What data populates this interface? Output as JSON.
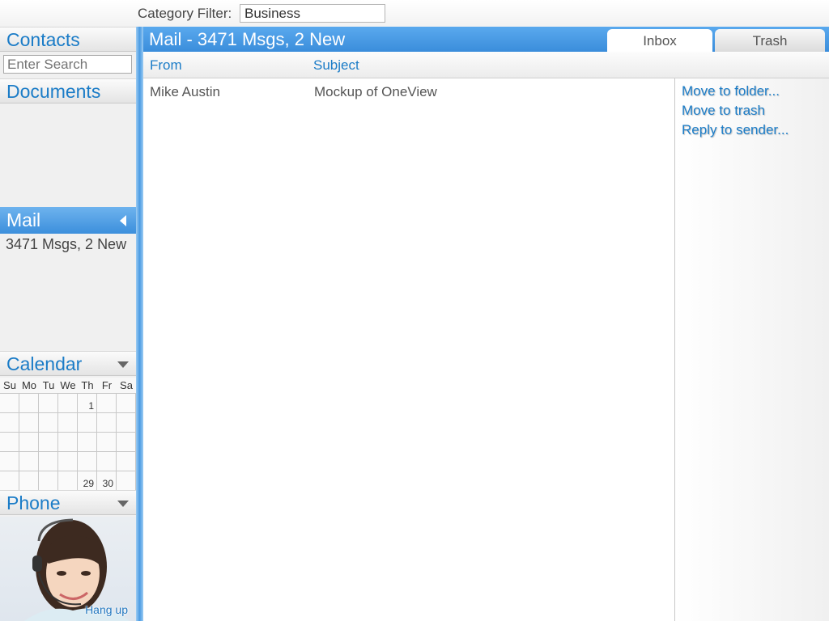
{
  "topbar": {
    "category_label": "Category Filter:",
    "category_value": "Business"
  },
  "sidebar": {
    "contacts": "Contacts",
    "search_placeholder": "Enter Search",
    "documents": "Documents",
    "mail": "Mail",
    "mail_summary": "3471 Msgs, 2 New",
    "calendar": "Calendar",
    "days": [
      "Su",
      "Mo",
      "Tu",
      "We",
      "Th",
      "Fr",
      "Sa"
    ],
    "dates": {
      "first": "1",
      "d29": "29",
      "d30": "30"
    },
    "phone": "Phone",
    "hangup": "Hang up"
  },
  "main": {
    "title": "Mail - 3471 Msgs, 2 New",
    "tabs": {
      "inbox": "Inbox",
      "trash": "Trash"
    },
    "columns": {
      "from": "From",
      "subject": "Subject"
    },
    "rows": [
      {
        "from": "Mike Austin",
        "subject": "Mockup of OneView"
      }
    ],
    "actions": {
      "move_folder": "Move to folder...",
      "move_trash": "Move to trash",
      "reply": "Reply to sender..."
    }
  },
  "colors": {
    "accent": "#1b7cc7",
    "header_blue": "#3a8ddb"
  }
}
